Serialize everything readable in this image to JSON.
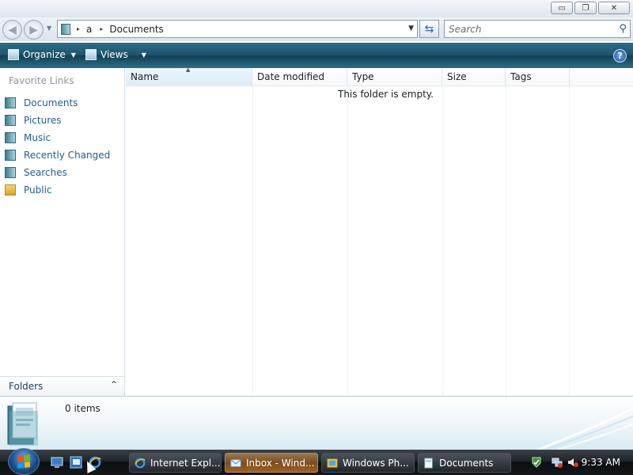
{
  "window": {
    "minimize_glyph": "▭",
    "maximize_glyph": "❐",
    "close_glyph": "✕"
  },
  "address_bar": {
    "breadcrumbs": [
      "a",
      "Documents"
    ],
    "separator": "▸",
    "dropdown_glyph": "▼",
    "refresh_glyph": "⇆"
  },
  "search": {
    "placeholder": "Search",
    "icon": "magnifier-icon"
  },
  "command_bar": {
    "organize_label": "Organize",
    "views_label": "Views",
    "help_label": "?"
  },
  "nav_pane": {
    "title": "Favorite Links",
    "items": [
      {
        "label": "Documents",
        "icon": "documents-icon"
      },
      {
        "label": "Pictures",
        "icon": "pictures-icon"
      },
      {
        "label": "Music",
        "icon": "music-icon"
      },
      {
        "label": "Recently Changed",
        "icon": "recently-changed-icon"
      },
      {
        "label": "Searches",
        "icon": "searches-icon"
      },
      {
        "label": "Public",
        "icon": "public-folder-icon"
      }
    ],
    "folders_label": "Folders",
    "folders_toggle_glyph": "⌃"
  },
  "file_list": {
    "columns": [
      "Name",
      "Date modified",
      "Type",
      "Size",
      "Tags"
    ],
    "sorted_column": "Name",
    "empty_message": "This folder is empty."
  },
  "details_pane": {
    "item_count": "0 items"
  },
  "taskbar": {
    "buttons": [
      {
        "label": "Internet Expl...",
        "icon": "internet-explorer-icon"
      },
      {
        "label": "Inbox - Wind...",
        "icon": "windows-mail-icon",
        "active": true
      },
      {
        "label": "Windows Ph...",
        "icon": "windows-photo-gallery-icon"
      },
      {
        "label": "Documents",
        "icon": "documents-folder-icon"
      }
    ],
    "clock": "9:33 AM"
  },
  "colors": {
    "command_bar": "#1e556d",
    "link_text": "#1f5e96",
    "taskbar": "#14181c",
    "active_task": "#7a4d1f"
  }
}
